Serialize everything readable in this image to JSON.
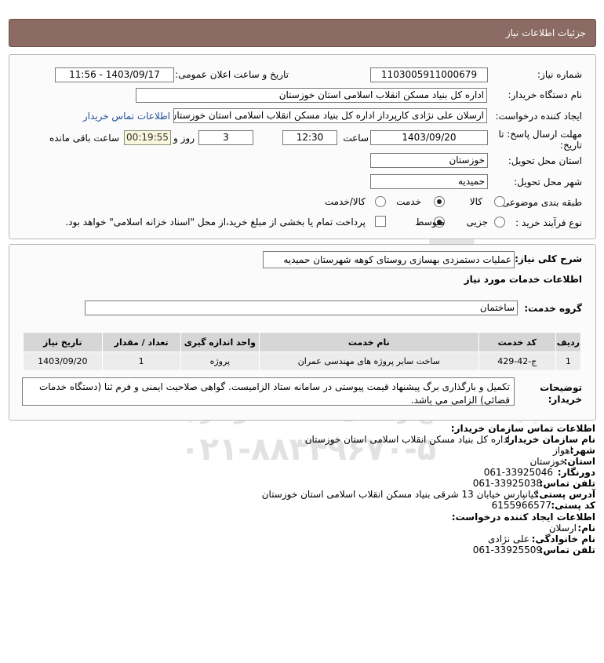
{
  "header": {
    "title": "جزئیات اطلاعات نیاز"
  },
  "form": {
    "need_number_label": "شماره نیاز:",
    "need_number": "1103005911000679",
    "announce_label": "تاریخ و ساعت اعلان عمومی:",
    "announce_value": "1403/09/17 - 11:56",
    "buyer_org_label": "نام دستگاه خریدار:",
    "buyer_org": "اداره کل بنیاد مسکن انقلاب اسلامی استان خوزستان",
    "creator_label": "ایجاد کننده درخواست:",
    "creator": "ارسلان علی نژادی کارپرداز اداره کل بنیاد مسکن انقلاب اسلامی استان خوزستان",
    "contact_link": "اطلاعات تماس خریدار",
    "deadline_label_1": "مهلت ارسال پاسخ: تا",
    "deadline_label_2": "تاریخ:",
    "deadline_date": "1403/09/20",
    "time_label": "ساعت",
    "deadline_time": "12:30",
    "days_value": "3",
    "days_label": "روز و",
    "remaining_time": "00:19:55",
    "remaining_label": "ساعت باقی مانده",
    "province_label": "استان محل تحویل:",
    "province": "خوزستان",
    "city_label": "شهر محل تحویل:",
    "city": "حمیدیه",
    "category_label": "طبقه بندی موضوعی:",
    "category_options": [
      "کالا",
      "خدمت",
      "کالا/خدمت"
    ],
    "category_selected": "خدمت",
    "process_label": "نوع فرآیند خرید :",
    "process_options": [
      "جزیی",
      "متوسط"
    ],
    "process_selected": "متوسط",
    "payment_text": "پرداخت تمام یا بخشی از مبلغ خرید،از محل \"اسناد خزانه اسلامی\" خواهد بود."
  },
  "details": {
    "desc_label": "شرح کلی نیاز:",
    "description": "عملیات دستمزدی بهسازی روستای کوهه شهرستان حمیدیه",
    "services_title": "اطلاعات خدمات مورد نیاز",
    "service_group_label": "گروه خدمت:",
    "service_group": "ساختمان",
    "table_headers": [
      "ردیف",
      "کد خدمت",
      "نام خدمت",
      "واحد اندازه گیری",
      "تعداد / مقدار",
      "تاریخ نیاز"
    ],
    "table_rows": [
      [
        "1",
        "ج-42-429",
        "ساخت سایر پروژه های مهندسی عمران",
        "پروژه",
        "1",
        "1403/09/20"
      ]
    ],
    "buyer_notes_label_1": "توضیحات",
    "buyer_notes_label_2": "خریدار:",
    "buyer_notes": "تکمیل و بارگذاری برگ پیشنهاد قیمت پیوستی در سامانه ستاد الزامیست. گواهی صلاحیت ایمنی و فرم ثنا (دستگاه خدمات قضائی) الزامی می باشد."
  },
  "contact": {
    "section_title": "اطلاعات تماس سازمان خریدار:",
    "org_name_label": "نام سازمان خریدار:",
    "org_name": "اداره کل بنیاد مسکن انقلاب اسلامی استان خوزستان",
    "province_label": "استان:",
    "province": "خوزستان",
    "city_label": "شهر:",
    "city": "اهواز",
    "fax_label": "دورنگار:",
    "fax": "061-33925046",
    "phone_label": "تلفن تماس:",
    "phone": "061-33925038",
    "address_label": "آدرس پستی:",
    "address": "کیانپارس خیابان 13 شرقی بنیاد مسکن انقلاب اسلامی استان خوزستان",
    "postal_label": "کد پستی:",
    "postal": "6155966577",
    "creator_title": "اطلاعات ایجاد کننده درخواست:",
    "first_name_label": "نام:",
    "first_name": "ارسلان",
    "last_name_label": "نام خانوادگی:",
    "last_name": "علی نژادی",
    "creator_phone_label": "تلفن تماس:",
    "creator_phone": "061-33925509"
  },
  "watermark": {
    "brand": "ParsNamadData",
    "line1": "پایگاه اطلاع رسانی مناقصه و مزایده",
    "phone": "۰۲۱-۸۸۳۴۹۶۷۰-۵",
    "digits": "0101"
  }
}
